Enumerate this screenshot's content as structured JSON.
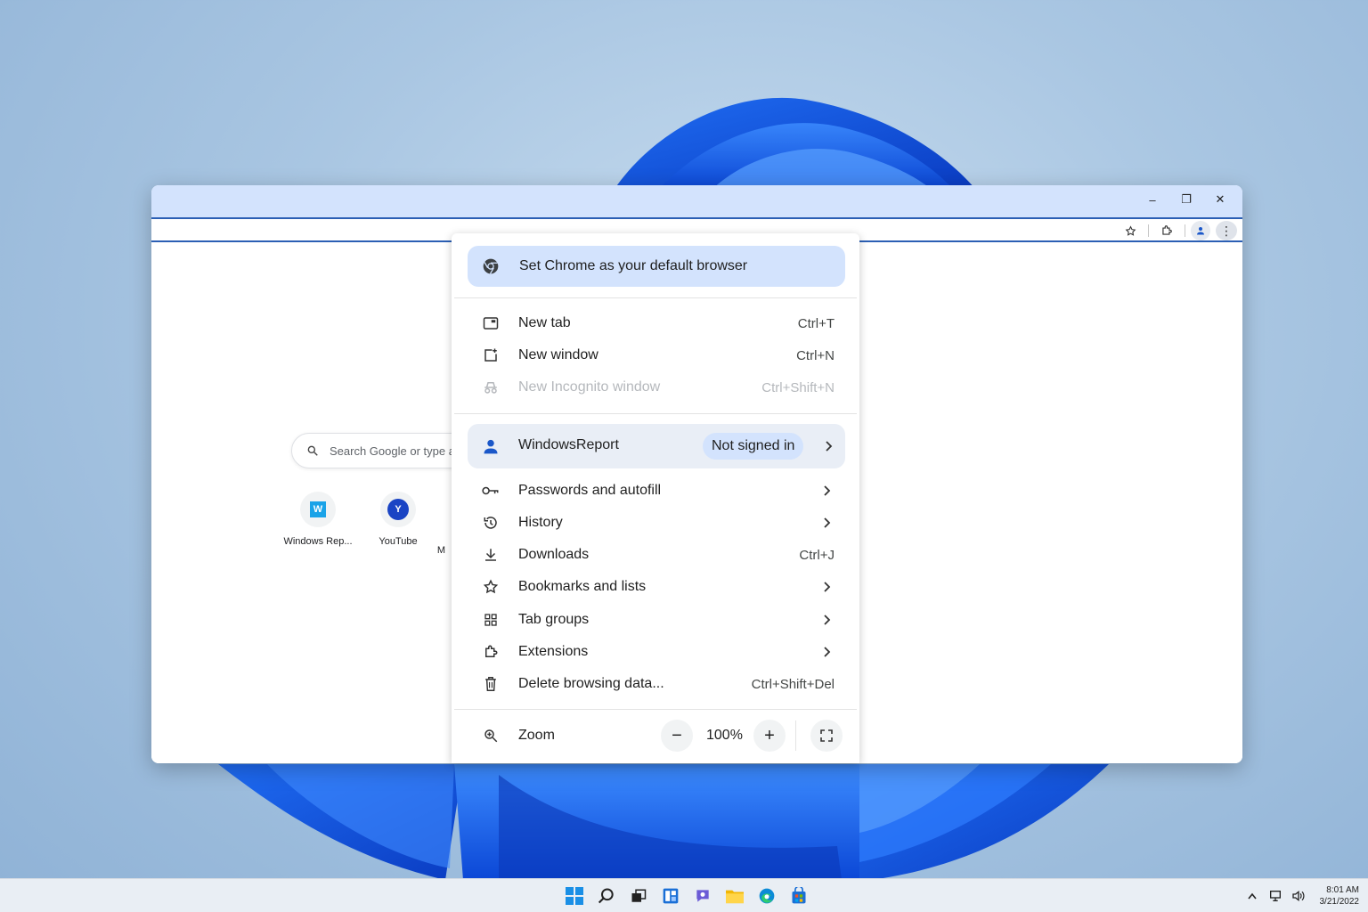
{
  "window": {
    "controls": {
      "minimize": "–",
      "maximize": "❐",
      "close": "✕"
    }
  },
  "newtab": {
    "search_placeholder": "Search Google or type a",
    "shortcuts": [
      {
        "label": "Windows Rep...",
        "glyph": "W"
      },
      {
        "label": "YouTube",
        "glyph": "Y"
      },
      {
        "label": "M",
        "glyph": ""
      }
    ]
  },
  "menu": {
    "default_browser": "Set Chrome as your default browser",
    "new_tab": {
      "label": "New tab",
      "shortcut": "Ctrl+T"
    },
    "new_window": {
      "label": "New window",
      "shortcut": "Ctrl+N"
    },
    "new_incognito": {
      "label": "New Incognito window",
      "shortcut": "Ctrl+Shift+N"
    },
    "profile": {
      "name": "WindowsReport",
      "status": "Not signed in"
    },
    "passwords": {
      "label": "Passwords and autofill"
    },
    "history": {
      "label": "History"
    },
    "downloads": {
      "label": "Downloads",
      "shortcut": "Ctrl+J"
    },
    "bookmarks": {
      "label": "Bookmarks and lists"
    },
    "tab_groups": {
      "label": "Tab groups"
    },
    "extensions": {
      "label": "Extensions"
    },
    "delete_data": {
      "label": "Delete browsing data...",
      "shortcut": "Ctrl+Shift+Del"
    },
    "zoom": {
      "label": "Zoom",
      "value": "100%",
      "minus": "−",
      "plus": "+"
    }
  },
  "taskbar": {
    "clock_time": "8:01 AM",
    "clock_date": "3/21/2022"
  },
  "colors": {
    "accent_blue": "#2b5fb4",
    "menu_highlight": "#d3e3fd",
    "profile_bg": "#e9eef6",
    "titlebar": "#d3e3fd"
  },
  "icons": [
    "chrome-icon",
    "new-tab-icon",
    "new-window-icon",
    "incognito-icon",
    "person-icon",
    "key-icon",
    "history-icon",
    "download-icon",
    "star-icon",
    "tab-groups-icon",
    "extension-icon",
    "trash-icon",
    "zoom-icon",
    "fullscreen-icon"
  ]
}
